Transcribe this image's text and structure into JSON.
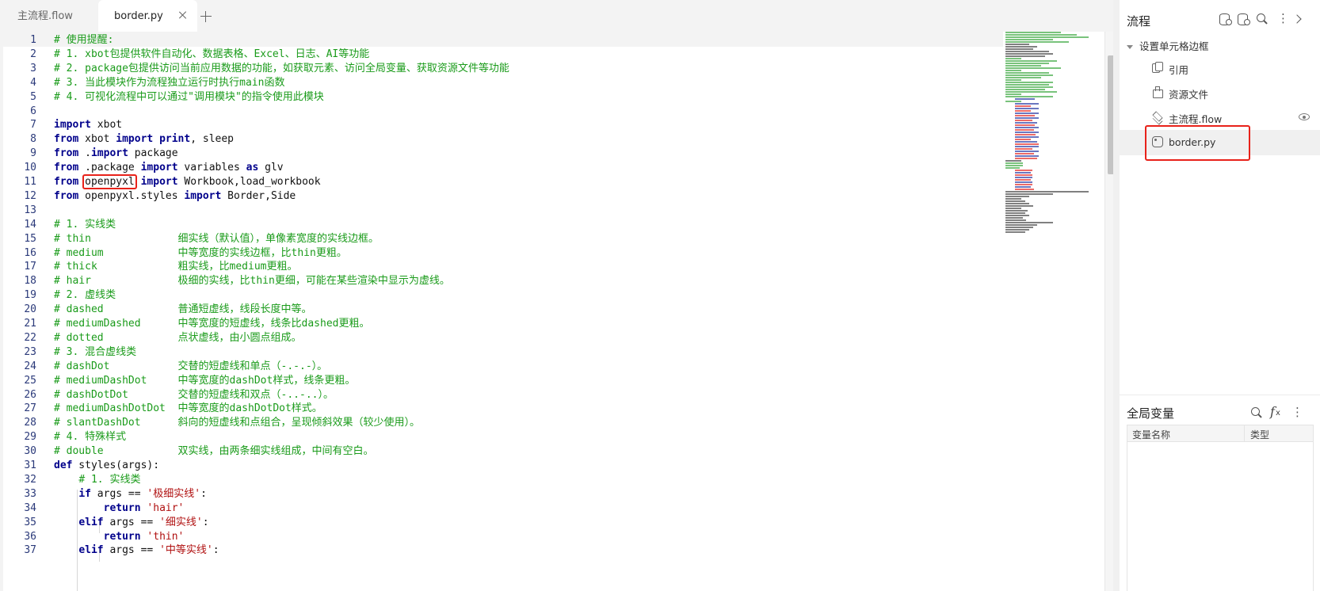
{
  "tabs": {
    "inactive_label": "主流程.flow",
    "active_label": "border.py"
  },
  "editor": {
    "lines": [
      [
        [
          "cm",
          "# 使用提醒:"
        ]
      ],
      [
        [
          "cm",
          "# 1. xbot包提供软件自动化、数据表格、Excel、日志、AI等功能"
        ]
      ],
      [
        [
          "cm",
          "# 2. package包提供访问当前应用数据的功能，如获取元素、访问全局变量、获取资源文件等功能"
        ]
      ],
      [
        [
          "cm",
          "# 3. 当此模块作为流程独立运行时执行main函数"
        ]
      ],
      [
        [
          "cm",
          "# 4. 可视化流程中可以通过\"调用模块\"的指令使用此模块"
        ]
      ],
      [],
      [
        [
          "kw",
          "import"
        ],
        [
          "",
          " xbot"
        ]
      ],
      [
        [
          "kw",
          "from"
        ],
        [
          "",
          " xbot "
        ],
        [
          "kw",
          "import"
        ],
        [
          "",
          " "
        ],
        [
          "kw",
          "print"
        ],
        [
          "",
          ", sleep"
        ]
      ],
      [
        [
          "kw",
          "from"
        ],
        [
          "",
          " ."
        ],
        [
          "kw",
          "import"
        ],
        [
          "",
          " package"
        ]
      ],
      [
        [
          "kw",
          "from"
        ],
        [
          "",
          " .package "
        ],
        [
          "kw",
          "import"
        ],
        [
          "",
          " variables "
        ],
        [
          "kw",
          "as"
        ],
        [
          "",
          " glv"
        ]
      ],
      [
        [
          "kw",
          "from"
        ],
        [
          "",
          " "
        ],
        [
          "hl",
          "openpyxl"
        ],
        [
          "",
          " "
        ],
        [
          "kw",
          "import"
        ],
        [
          "",
          " Workbook,load_workbook"
        ]
      ],
      [
        [
          "kw",
          "from"
        ],
        [
          "",
          " openpyxl.styles "
        ],
        [
          "kw",
          "import"
        ],
        [
          "",
          " Border,Side"
        ]
      ],
      [],
      [
        [
          "cm",
          "# 1. 实线类"
        ]
      ],
      [
        [
          "cm",
          "# thin              细实线（默认值），单像素宽度的实线边框。"
        ]
      ],
      [
        [
          "cm",
          "# medium            中等宽度的实线边框，比thin更粗。"
        ]
      ],
      [
        [
          "cm",
          "# thick             粗实线，比medium更粗。"
        ]
      ],
      [
        [
          "cm",
          "# hair              极细的实线，比thin更细，可能在某些渲染中显示为虚线。"
        ]
      ],
      [
        [
          "cm",
          "# 2. 虚线类"
        ]
      ],
      [
        [
          "cm",
          "# dashed            普通短虚线，线段长度中等。"
        ]
      ],
      [
        [
          "cm",
          "# mediumDashed      中等宽度的短虚线，线条比dashed更粗。"
        ]
      ],
      [
        [
          "cm",
          "# dotted            点状虚线，由小圆点组成。"
        ]
      ],
      [
        [
          "cm",
          "# 3. 混合虚线类"
        ]
      ],
      [
        [
          "cm",
          "# dashDot           交替的短虚线和单点（-.-.-）。"
        ]
      ],
      [
        [
          "cm",
          "# mediumDashDot     中等宽度的dashDot样式，线条更粗。"
        ]
      ],
      [
        [
          "cm",
          "# dashDotDot        交替的短虚线和双点（-..-..）。"
        ]
      ],
      [
        [
          "cm",
          "# mediumDashDotDot  中等宽度的dashDotDot样式。"
        ]
      ],
      [
        [
          "cm",
          "# slantDashDot      斜向的短虚线和点组合，呈现倾斜效果（较少使用）。"
        ]
      ],
      [
        [
          "cm",
          "# 4. 特殊样式"
        ]
      ],
      [
        [
          "cm",
          "# double            双实线，由两条细实线组成，中间有空白。"
        ]
      ],
      [
        [
          "kw",
          "def"
        ],
        [
          "",
          " styles(args):"
        ]
      ],
      [
        [
          "",
          "    "
        ],
        [
          "cm",
          "# 1. 实线类"
        ]
      ],
      [
        [
          "",
          "    "
        ],
        [
          "kw",
          "if"
        ],
        [
          "",
          " args == "
        ],
        [
          "st",
          "'极细实线'"
        ],
        [
          "",
          ":"
        ]
      ],
      [
        [
          "",
          "        "
        ],
        [
          "kw",
          "return"
        ],
        [
          "",
          " "
        ],
        [
          "st",
          "'hair'"
        ]
      ],
      [
        [
          "",
          "    "
        ],
        [
          "kw",
          "elif"
        ],
        [
          "",
          " args == "
        ],
        [
          "st",
          "'细实线'"
        ],
        [
          "",
          ":"
        ]
      ],
      [
        [
          "",
          "        "
        ],
        [
          "kw",
          "return"
        ],
        [
          "",
          " "
        ],
        [
          "st",
          "'thin'"
        ]
      ],
      [
        [
          "",
          "    "
        ],
        [
          "kw",
          "elif"
        ],
        [
          "",
          " args == "
        ],
        [
          "st",
          "'中等实线'"
        ],
        [
          "",
          ":"
        ]
      ]
    ]
  },
  "flow_panel": {
    "title": "流程",
    "root_label": "设置单元格边框",
    "items": [
      {
        "label": "引用",
        "icon": "reference-icon"
      },
      {
        "label": "资源文件",
        "icon": "resource-file-icon"
      },
      {
        "label": "主流程.flow",
        "icon": "flow-layers-icon"
      },
      {
        "label": "border.py",
        "icon": "python-file-icon"
      }
    ]
  },
  "vars_panel": {
    "title": "全局变量",
    "col_name": "变量名称",
    "col_type": "类型"
  },
  "colors": {
    "comment": "#1a9b1a",
    "keyword": "#00008b",
    "string": "#b01010",
    "highlight_box": "#e8221a",
    "line_number": "#2b3a7a"
  }
}
